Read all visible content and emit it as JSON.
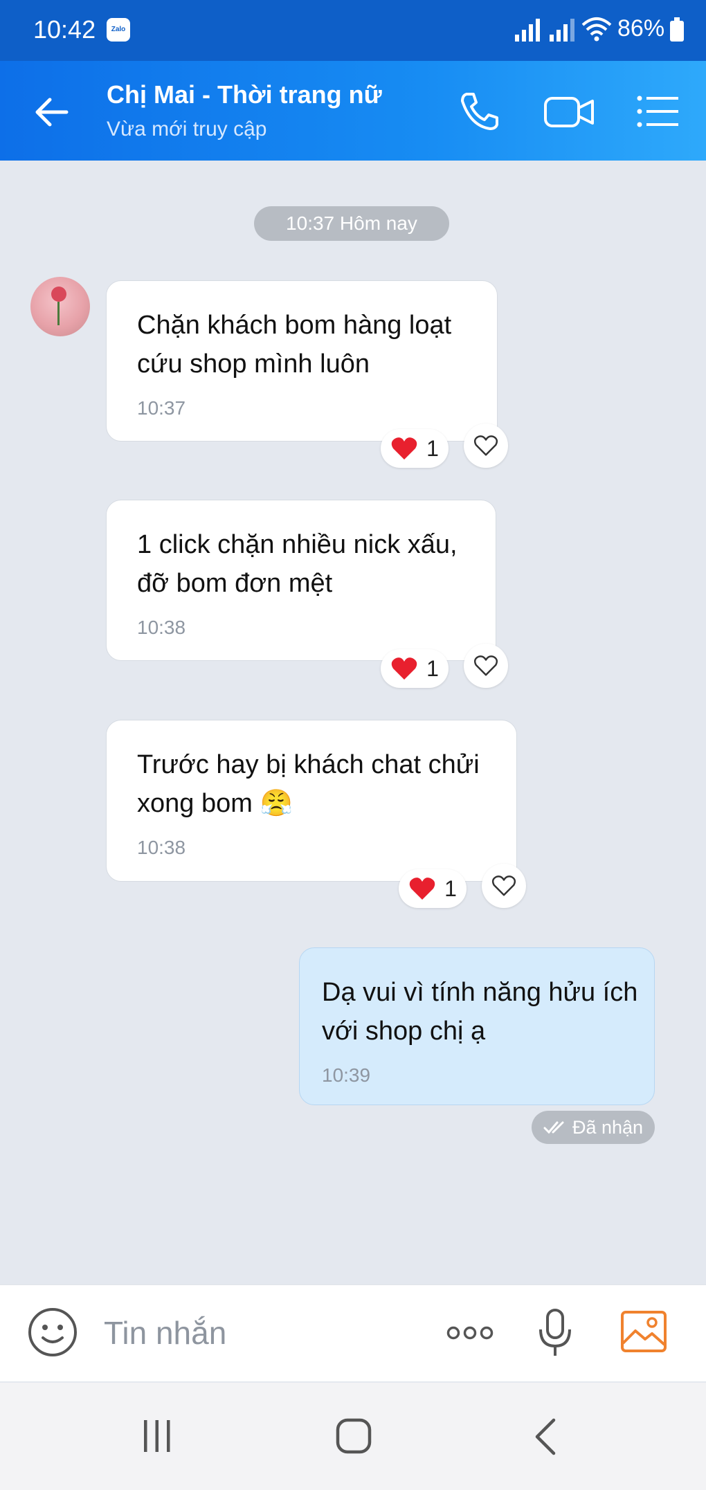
{
  "status_bar": {
    "time": "10:42",
    "app_badge": "Zalo",
    "battery": "86%"
  },
  "header": {
    "title": "Chị Mai - Thời trang nữ",
    "subtitle": "Vừa mới truy cập"
  },
  "date_divider": "10:37 Hôm nay",
  "messages": [
    {
      "text": "Chặn khách bom hàng loạt\ncứu shop mình luôn",
      "time": "10:37",
      "reaction_count": "1"
    },
    {
      "text": "1 click chặn nhiều nick xấu,\nđỡ bom đơn mệt",
      "time": "10:38",
      "reaction_count": "1"
    },
    {
      "text": "Trước hay bị khách chat chửi\nxong bom 😤",
      "time": "10:38",
      "reaction_count": "1"
    },
    {
      "text": "Dạ vui vì tính năng hửu ích\nvới shop chị ạ",
      "time": "10:39"
    }
  ],
  "delivery_status": "Đã nhận",
  "composer": {
    "placeholder": "Tin nhắn"
  },
  "colors": {
    "header_start": "#0d6fe8",
    "header_end": "#2ea9fb",
    "outgoing_bubble": "#d5ebfc",
    "heart": "#e8202e",
    "image_icon": "#f0822e"
  },
  "icons": [
    "back-arrow-icon",
    "phone-icon",
    "video-camera-icon",
    "menu-icon",
    "heart-icon",
    "like-heart-icon",
    "double-check-icon",
    "emoji-icon",
    "more-icon",
    "microphone-icon",
    "image-icon",
    "recent-apps-icon",
    "home-icon",
    "nav-back-icon"
  ]
}
